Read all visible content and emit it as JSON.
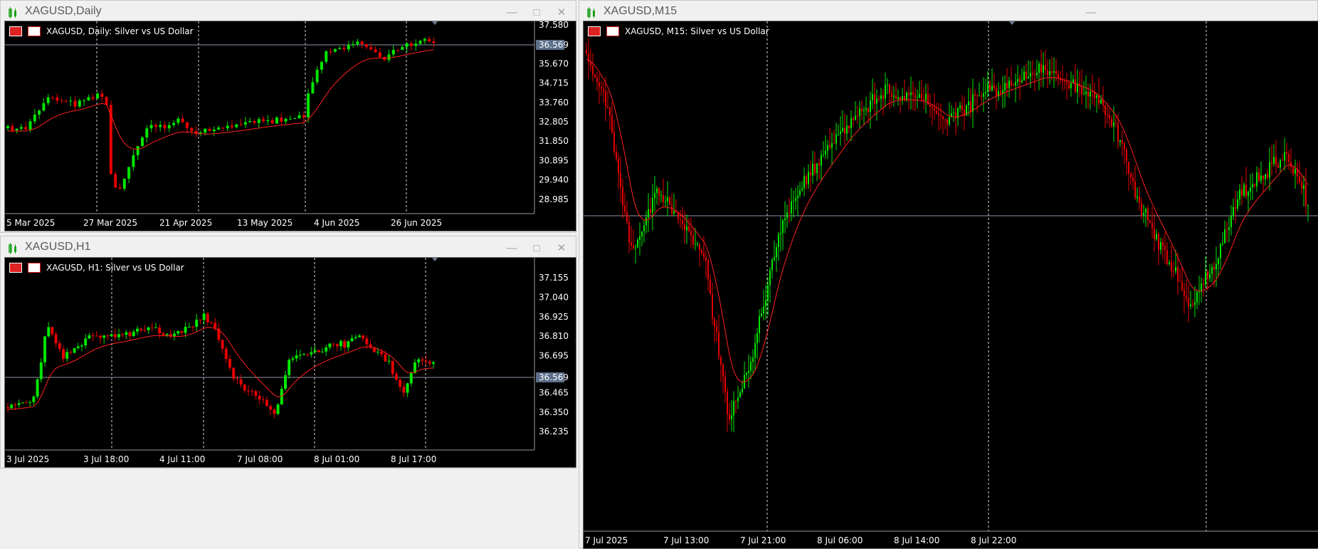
{
  "windows": [
    {
      "id": "daily",
      "title": "XAGUSD,Daily",
      "header": "XAGUSD, Daily:  Silver vs US Dollar",
      "price_label": "36.569",
      "y_ticks": [
        "37.580",
        "36.569",
        "35.670",
        "34.715",
        "33.760",
        "32.805",
        "31.850",
        "30.895",
        "29.940",
        "28.985"
      ],
      "x_ticks": [
        "5 Mar 2025",
        "27 Mar 2025",
        "21 Apr 2025",
        "13 May 2025",
        "4 Jun 2025",
        "26 Jun 2025"
      ]
    },
    {
      "id": "h1",
      "title": "XAGUSD,H1",
      "header": "XAGUSD, H1:  Silver vs US Dollar",
      "price_label": "36.569",
      "y_ticks": [
        "37.155",
        "37.040",
        "36.925",
        "36.810",
        "36.695",
        "36.569",
        "36.465",
        "36.350",
        "36.235"
      ],
      "x_ticks": [
        "3 Jul 2025",
        "3 Jul 18:00",
        "4 Jul 11:00",
        "7 Jul 08:00",
        "8 Jul 01:00",
        "8 Jul 17:00"
      ]
    },
    {
      "id": "m15",
      "title": "XAGUSD,M15",
      "header": "XAGUSD, M15:  Silver vs US Dollar",
      "price_label": "",
      "y_ticks": [],
      "x_ticks": [
        "7 Jul 2025",
        "7 Jul 13:00",
        "7 Jul 21:00",
        "8 Jul 06:00",
        "8 Jul 14:00",
        "8 Jul 22:00"
      ]
    }
  ],
  "colors": {
    "bull": "#00e600",
    "bear": "#e60000",
    "ma": "#ff2020",
    "grid": "#ffffff",
    "price_line": "#8a96a8",
    "price_label_bg": "#5c6f8a"
  }
}
